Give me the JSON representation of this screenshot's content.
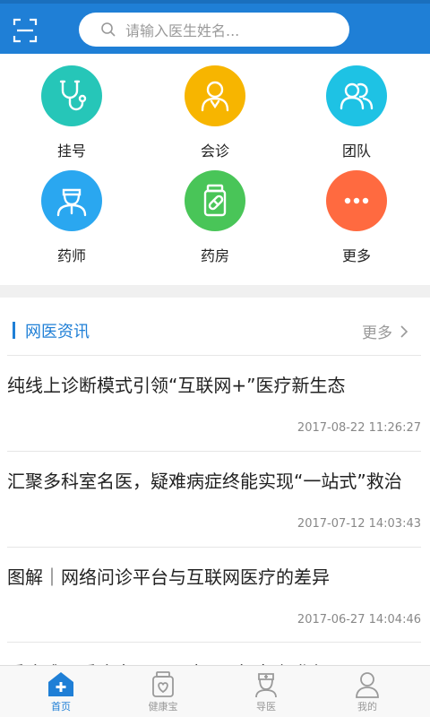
{
  "search": {
    "placeholder": "请输入医生姓名..."
  },
  "colors": {
    "primary": "#1f7fd6",
    "teal": "#26c6b8",
    "yellow": "#f7b500",
    "cyan": "#1ec2e4",
    "sky": "#2aa7f0",
    "green": "#49c558",
    "orange": "#ff6a40"
  },
  "menu": [
    {
      "label": "挂号",
      "icon": "stethoscope-icon"
    },
    {
      "label": "会诊",
      "icon": "doctor-icon"
    },
    {
      "label": "团队",
      "icon": "team-icon"
    },
    {
      "label": "药师",
      "icon": "pharmacist-icon"
    },
    {
      "label": "药房",
      "icon": "medicine-jar-icon"
    },
    {
      "label": "更多",
      "icon": "more-dots-icon"
    }
  ],
  "news": {
    "title": "网医资讯",
    "more": "更多",
    "items": [
      {
        "title": "纯线上诊断模式引领“互联网+”医疗新生态",
        "date": "2017-08-22 11:26:27"
      },
      {
        "title": "汇聚多科室名医，疑难病症终能实现“一站式”救治",
        "date": "2017-07-12 14:03:43"
      },
      {
        "title": "图解｜网络问诊平台与互联网医疗的差异",
        "date": "2017-06-27 14:04:46"
      },
      {
        "title": "看病难、看病贵——医疗“顽疾”如何化解？",
        "date": ""
      }
    ]
  },
  "tabs": [
    {
      "label": "首页",
      "icon": "home-cross-icon",
      "active": true
    },
    {
      "label": "健康宝",
      "icon": "health-box-icon",
      "active": false
    },
    {
      "label": "导医",
      "icon": "nurse-icon",
      "active": false
    },
    {
      "label": "我的",
      "icon": "person-icon",
      "active": false
    }
  ]
}
